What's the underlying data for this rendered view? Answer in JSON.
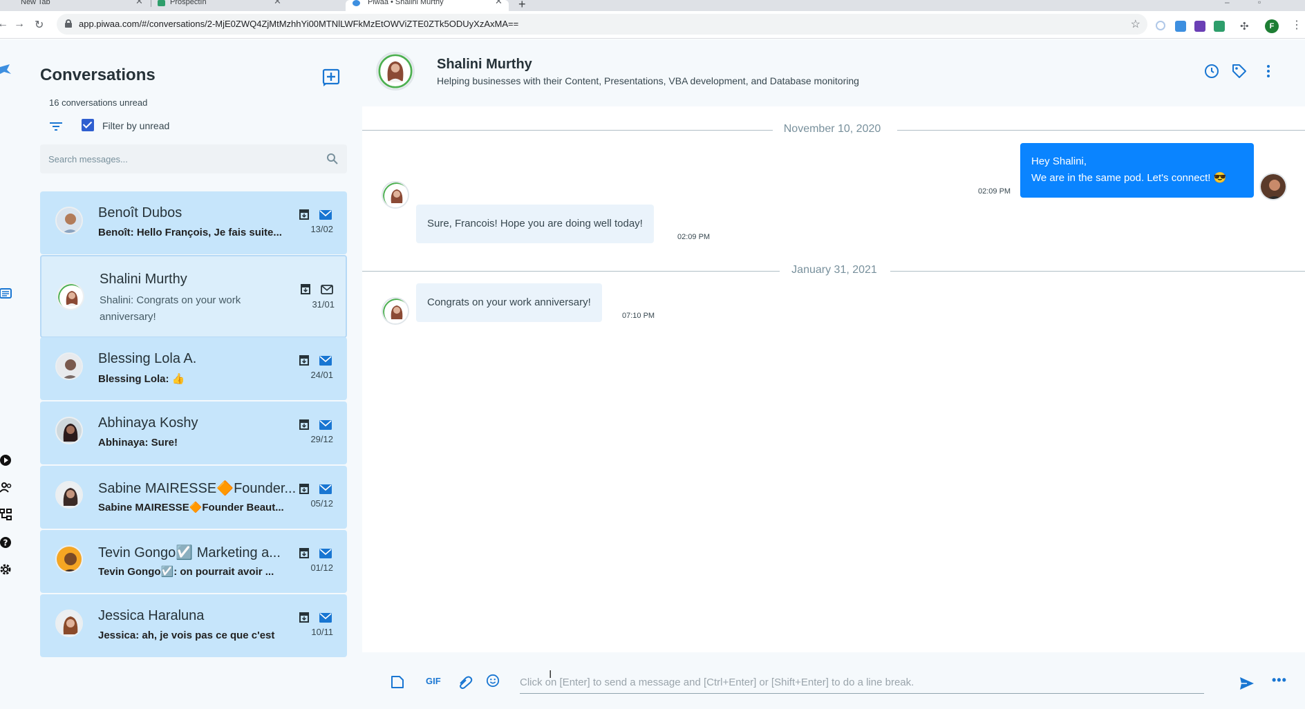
{
  "browser": {
    "tabs": [
      {
        "title": "New Tab"
      },
      {
        "title": "ProspectIn"
      },
      {
        "title": "Piwaa • Shalini Murthy"
      }
    ],
    "url": "app.piwaa.com/#/conversations/2-MjE0ZWQ4ZjMtMzhhYi00MTNlLWFkMzEtOWViZTE0ZTk5ODUyXzAxMA==",
    "profile_initial": "F"
  },
  "sidebar": {
    "title": "Conversations",
    "unread_text": "16 conversations unread",
    "filter_label": "Filter by unread",
    "search_placeholder": "Search messages..."
  },
  "conversations": [
    {
      "name": "Benoît Dubos",
      "preview": "Benoît: Hello François, Je fais suite...",
      "date": "13/02",
      "avatar_color": "#8aa3c0"
    },
    {
      "name": "Shalini Murthy",
      "preview": "Shalini: Congrats on your work anniversary!",
      "date": "31/01",
      "avatar_color": "#c98a7a"
    },
    {
      "name": "Blessing Lola A.",
      "preview": "Blessing Lola: 👍",
      "date": "24/01",
      "avatar_color": "#7a6a66"
    },
    {
      "name": "Abhinaya Koshy",
      "preview": "Abhinaya: Sure!",
      "date": "29/12",
      "avatar_color": "#3b2a2a"
    },
    {
      "name": "Sabine MAIRESSE🔶Founder...",
      "preview": "Sabine MAIRESSE🔶Founder Beaut...",
      "date": "05/12",
      "avatar_color": "#4a3a36"
    },
    {
      "name": "Tevin Gongo☑️ Marketing a...",
      "preview": "Tevin Gongo☑️: on pourrait avoir ...",
      "date": "01/12",
      "avatar_color": "#b5651d"
    },
    {
      "name": "Jessica Haraluna",
      "preview": "Jessica: ah, je vois pas ce que c'est",
      "date": "10/11",
      "avatar_color": "#c9826a"
    }
  ],
  "chat": {
    "contact_name": "Shalini Murthy",
    "contact_headline": "Helping businesses with their Content, Presentations, VBA development, and Database monitoring",
    "date_1": "November 10, 2020",
    "date_2": "January 31, 2021",
    "messages": [
      {
        "direction": "out",
        "line1": "Hey Shalini,",
        "line2": "We are in the same pod. Let's connect! 😎",
        "time": "02:09 PM"
      },
      {
        "direction": "in",
        "text": "Sure, Francois! Hope you are doing well today!",
        "time": "02:09 PM"
      },
      {
        "direction": "in",
        "text": "Congrats on your work anniversary!",
        "time": "07:10 PM"
      }
    ],
    "composer_placeholder": "Click on [Enter] to send a message and [Ctrl+Enter] or [Shift+Enter] to do a line break.",
    "gif_label": "GIF"
  },
  "colors": {
    "accent": "#1976d2",
    "card_bg": "#c6e5fb",
    "outgoing_bubble": "#0a84ff",
    "incoming_bubble": "#eaf3fb"
  },
  "icons": [
    "new-conversation-icon",
    "filter-icon",
    "search-icon",
    "archive-icon",
    "mail-icon",
    "history-icon",
    "tag-icon",
    "more-vert-icon",
    "file-icon",
    "attachment-icon",
    "emoji-icon",
    "send-icon"
  ]
}
